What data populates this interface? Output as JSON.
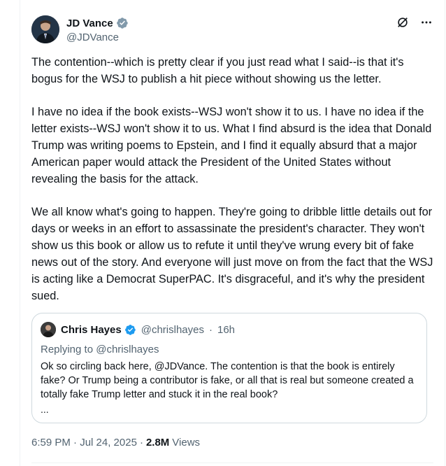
{
  "author": {
    "display_name": "JD Vance",
    "handle": "@JDVance",
    "verified_color": "#1d9bf0",
    "icons": [
      "verified-badge-icon",
      "grok-icon",
      "more-icon"
    ]
  },
  "body": {
    "paragraphs": [
      "The contention--which is pretty clear if you just read what I said--is that it's bogus for the WSJ to publish a hit piece without showing us the letter.",
      "I have no idea if the book exists--WSJ won't show it to us. I have no idea if the letter exists--WSJ won't show it to us. What I find absurd is the idea that Donald Trump was writing poems to Epstein, and I find it equally absurd that a major American paper would attack the President of the United States without revealing the basis for the attack.",
      "We all know what's going to happen. They're going to dribble little details out for days or weeks in an effort to assassinate the president's character. They won't show us this book or allow us to refute it until they've wrung every bit of fake news out of the story. And everyone will just move on from the fact that the WSJ is acting like a Democrat SuperPAC. It's disgraceful, and it's why the president sued."
    ]
  },
  "quote": {
    "display_name": "Chris Hayes",
    "handle": "@chrislhayes",
    "separator": "·",
    "time": "16h",
    "replying_to": "Replying to @chrislhayes",
    "text": "Ok so circling back here, @JDVance. The contention is that the book is entirely fake? Or Trump being a contributor is fake, or all that is real but someone created a totally fake Trump letter and stuck it in the real book?",
    "ellipsis": "..."
  },
  "footer": {
    "timestamp": "6:59 PM · Jul 24, 2025",
    "separator": "·",
    "views_count": "2.8M",
    "views_label": "Views"
  }
}
